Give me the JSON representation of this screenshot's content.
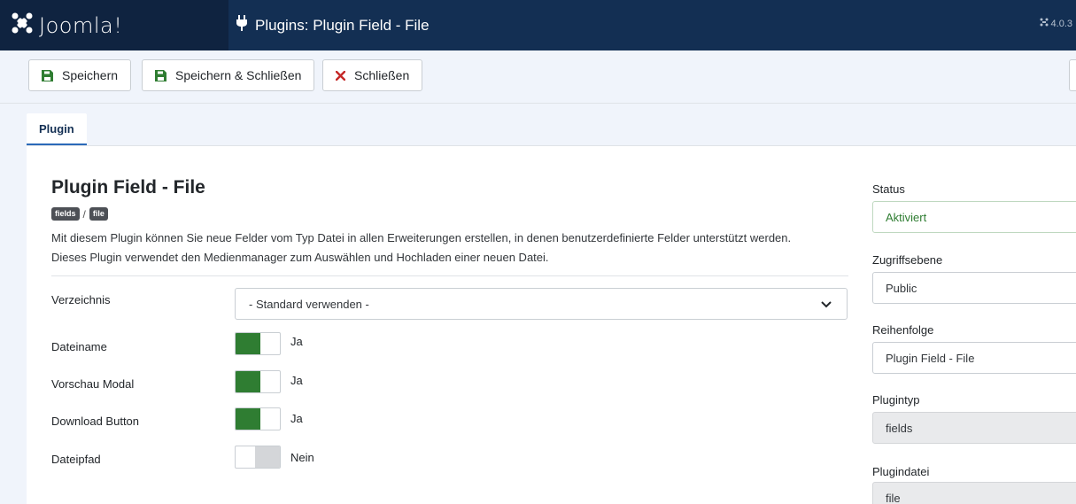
{
  "header": {
    "logo_text": "Joomla!",
    "page_title": "Plugins: Plugin Field - File",
    "version": "4.0.3"
  },
  "toolbar": {
    "save_label": "Speichern",
    "save_close_label": "Speichern & Schließen",
    "close_label": "Schließen"
  },
  "tabs": [
    {
      "label": "Plugin",
      "active": true
    }
  ],
  "plugin": {
    "title": "Plugin Field - File",
    "tag_group": "fields",
    "tag_separator": "/",
    "tag_element": "file",
    "description_line1": "Mit diesem Plugin können Sie neue Felder vom Typ Datei in allen Erweiterungen erstellen, in denen benutzerdefinierte Felder unterstützt werden.",
    "description_line2": "Dieses Plugin verwendet den Medienmanager zum Auswählen und Hochladen einer neuen Datei."
  },
  "fields": {
    "directory": {
      "label": "Verzeichnis",
      "value": "- Standard verwenden -"
    },
    "filename": {
      "label": "Dateiname",
      "state": "Ja",
      "on": true
    },
    "preview_modal": {
      "label": "Vorschau Modal",
      "state": "Ja",
      "on": true
    },
    "download_button": {
      "label": "Download Button",
      "state": "Ja",
      "on": true
    },
    "filepath": {
      "label": "Dateipfad",
      "state": "Nein",
      "on": false
    }
  },
  "sidebar": {
    "status": {
      "label": "Status",
      "value": "Aktiviert"
    },
    "access": {
      "label": "Zugriffsebene",
      "value": "Public"
    },
    "ordering": {
      "label": "Reihenfolge",
      "value": "Plugin Field - File"
    },
    "plugin_type": {
      "label": "Plugintyp",
      "value": "fields"
    },
    "plugin_file": {
      "label": "Plugindatei",
      "value": "file"
    }
  },
  "colors": {
    "header_bg": "#132f53",
    "toggle_on": "#2f7d32",
    "status_text": "#2f7d32",
    "close_icon": "#c52827"
  }
}
